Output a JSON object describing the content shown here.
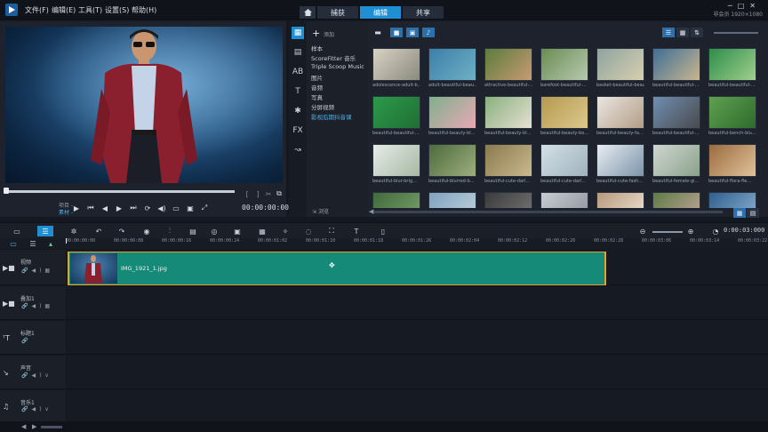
{
  "menu": [
    "文件(F)",
    "编辑(E)",
    "工具(T)",
    "设置(S)",
    "帮助(H)"
  ],
  "tabs": [
    {
      "label": "捕获",
      "active": false
    },
    {
      "label": "编辑",
      "active": true
    },
    {
      "label": "共享",
      "active": false
    }
  ],
  "user": {
    "line1": "非会员",
    "line2": "1920×1080"
  },
  "player": {
    "project_label": "项目 -",
    "clip_label": "素材 -",
    "timecode": "00:00:00:00"
  },
  "library": {
    "add_label": "添加",
    "browse_label": "浏览",
    "folders": [
      {
        "label": "样本",
        "active": false
      },
      {
        "label": "ScoreFitter 音乐",
        "active": false
      },
      {
        "label": "Triple Scoop Music",
        "active": false
      },
      {
        "label": "图片",
        "active": false
      },
      {
        "label": "音频",
        "active": false
      },
      {
        "label": "写真",
        "active": false
      },
      {
        "label": "分屏视频",
        "active": false
      },
      {
        "label": "影视后期抖音课",
        "active": true
      }
    ],
    "thumbnails": [
      "adolescence-adult-b...",
      "adult-beautiful-beau...",
      "attractive-beautiful-...",
      "barefoot-beautiful-...",
      "basket-beautiful-beaut...",
      "beautiful-beautiful-...",
      "beautiful-beautiful-...",
      "beautiful-beautiful-...",
      "beautiful-beauty-bl...",
      "beautiful-beauty-bl...",
      "beautiful-beauty-bo...",
      "beautiful-beauty-fa...",
      "beautiful-beautiful-...",
      "beautiful-bench-blu...",
      "beautiful-blur-brig...",
      "beautiful-blurred-b...",
      "beautiful-cute-darl...",
      "beautiful-cute-darl...",
      "beautiful-cute-fash...",
      "beautiful-female-gi...",
      "beautiful-flora-fle...",
      "",
      "",
      "",
      "",
      "",
      "",
      ""
    ]
  },
  "timeline": {
    "timecode": "0:00:03:000",
    "ruler": [
      "00:00:00:00",
      "00:00:00:08",
      "00:00:00:16",
      "00:00:00:24",
      "00:00:01:02",
      "00:00:01:10",
      "00:00:01:18",
      "00:00:01:26",
      "00:00:02:04",
      "00:00:02:12",
      "00:00:02:20",
      "00:00:02:28",
      "00:00:03:06",
      "00:00:03:14",
      "00:00:03:22"
    ],
    "tracks": [
      "视频",
      "叠加1",
      "标题1",
      "声音",
      "音乐1"
    ],
    "clip_name": "IMG_1921_1.jpg"
  },
  "colors": {
    "accent": "#1e8fd2",
    "clip": "#168a78",
    "clip_border": "#e3a22a"
  }
}
